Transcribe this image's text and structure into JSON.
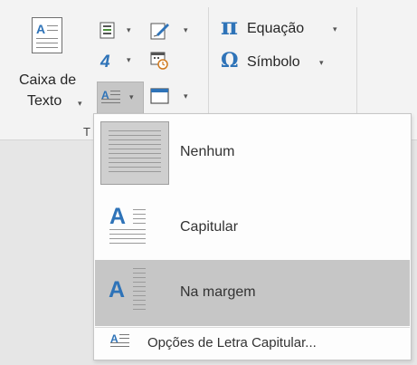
{
  "ribbon": {
    "text_box": {
      "label_line1": "Caixa de",
      "label_line2": "Texto",
      "icon_letter": "A"
    },
    "equation": {
      "symbol": "π",
      "label": "Equação"
    },
    "symbol": {
      "symbol": "Ω",
      "label": "Símbolo"
    },
    "group_label": "T"
  },
  "dropcap_menu": {
    "items": [
      {
        "label": "Nenhum",
        "icon": "dropcap-none-icon"
      },
      {
        "label": "Capitular",
        "icon": "dropcap-dropped-icon",
        "letter": "A"
      },
      {
        "label": "Na margem",
        "icon": "dropcap-margin-icon",
        "letter": "A"
      }
    ],
    "options_label": "Opções de Letra Capitular...",
    "options_icon_letter": "A"
  },
  "colors": {
    "accent_blue": "#2e73b8",
    "selected_bg": "#c6c6c6",
    "ribbon_bg": "#f3f3f3",
    "page_bg": "#e6e6e6"
  }
}
